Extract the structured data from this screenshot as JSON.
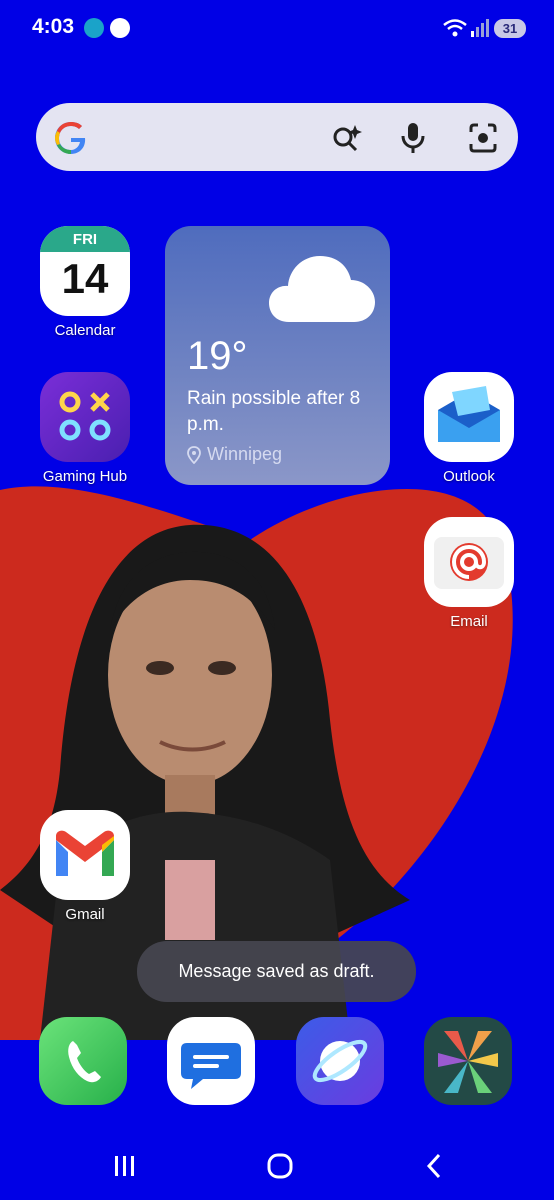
{
  "status_bar": {
    "time": "4:03",
    "battery": "31",
    "notification_icons": [
      "edge-icon",
      "sports-ball-icon"
    ],
    "system_icons": [
      "wifi-icon",
      "signal-icon",
      "battery-icon"
    ]
  },
  "search_bar": {
    "icons": [
      "google-logo",
      "ai-search-icon",
      "microphone-icon",
      "lens-camera-icon"
    ]
  },
  "calendar_widget": {
    "day": "FRI",
    "date": "14"
  },
  "apps": [
    {
      "label": "Calendar",
      "icon": "calendar-icon"
    },
    {
      "label": "Gaming Hub",
      "icon": "gaming-hub-icon"
    },
    {
      "label": "Outlook",
      "icon": "outlook-icon"
    },
    {
      "label": "Email",
      "icon": "email-icon"
    },
    {
      "label": "Gmail",
      "icon": "gmail-icon"
    }
  ],
  "weather": {
    "temperature": "19°",
    "description": "Rain possible after 8 p.m.",
    "location": "Winnipeg",
    "icon": "cloud-icon"
  },
  "toast": {
    "message": "Message saved as draft."
  },
  "dock": [
    "phone-icon",
    "messages-icon",
    "internet-browser-icon",
    "multicolor-app-icon"
  ],
  "nav_bar": [
    "recents-icon",
    "home-icon",
    "back-icon"
  ],
  "colors": {
    "background": "#0000e6",
    "heart": "#cc2a1e",
    "toast_bg": "#46464f",
    "weather_top": "#4f6cbe"
  }
}
